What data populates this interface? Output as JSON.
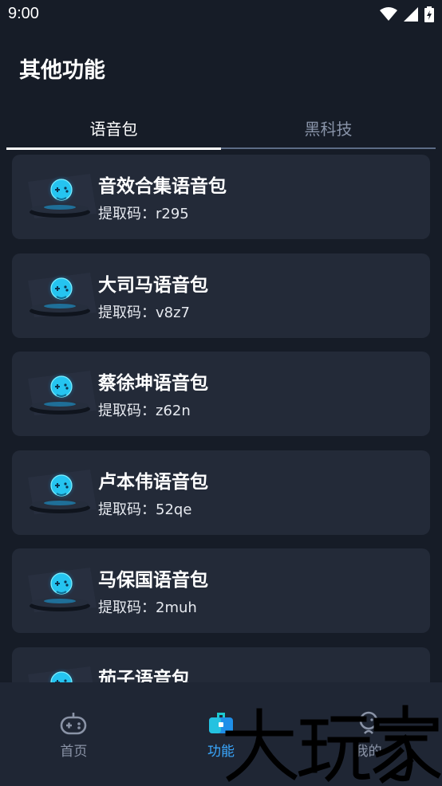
{
  "status": {
    "time": "9:00"
  },
  "header": {
    "title": "其他功能"
  },
  "tabs": [
    {
      "label": "语音包",
      "active": true
    },
    {
      "label": "黑科技",
      "active": false
    }
  ],
  "items": [
    {
      "title": "音效合集语音包",
      "code": "提取码：r295"
    },
    {
      "title": "大司马语音包",
      "code": "提取码：v8z7"
    },
    {
      "title": "蔡徐坤语音包",
      "code": "提取码：z62n"
    },
    {
      "title": "卢本伟语音包",
      "code": "提取码：52qe"
    },
    {
      "title": "马保国语音包",
      "code": "提取码：2muh"
    },
    {
      "title": "茄子语音包",
      "code": ""
    }
  ],
  "nav": [
    {
      "label": "首页",
      "icon": "gamepad-icon",
      "active": false
    },
    {
      "label": "功能",
      "icon": "toolbox-icon",
      "active": true
    },
    {
      "label": "我的",
      "icon": "person-chat-icon",
      "active": false
    }
  ],
  "watermark": {
    "text": "大玩家"
  },
  "colors": {
    "background": "#161c27",
    "card": "#232a38",
    "accent": "#3aa8ff",
    "nav": "#1f2634"
  }
}
